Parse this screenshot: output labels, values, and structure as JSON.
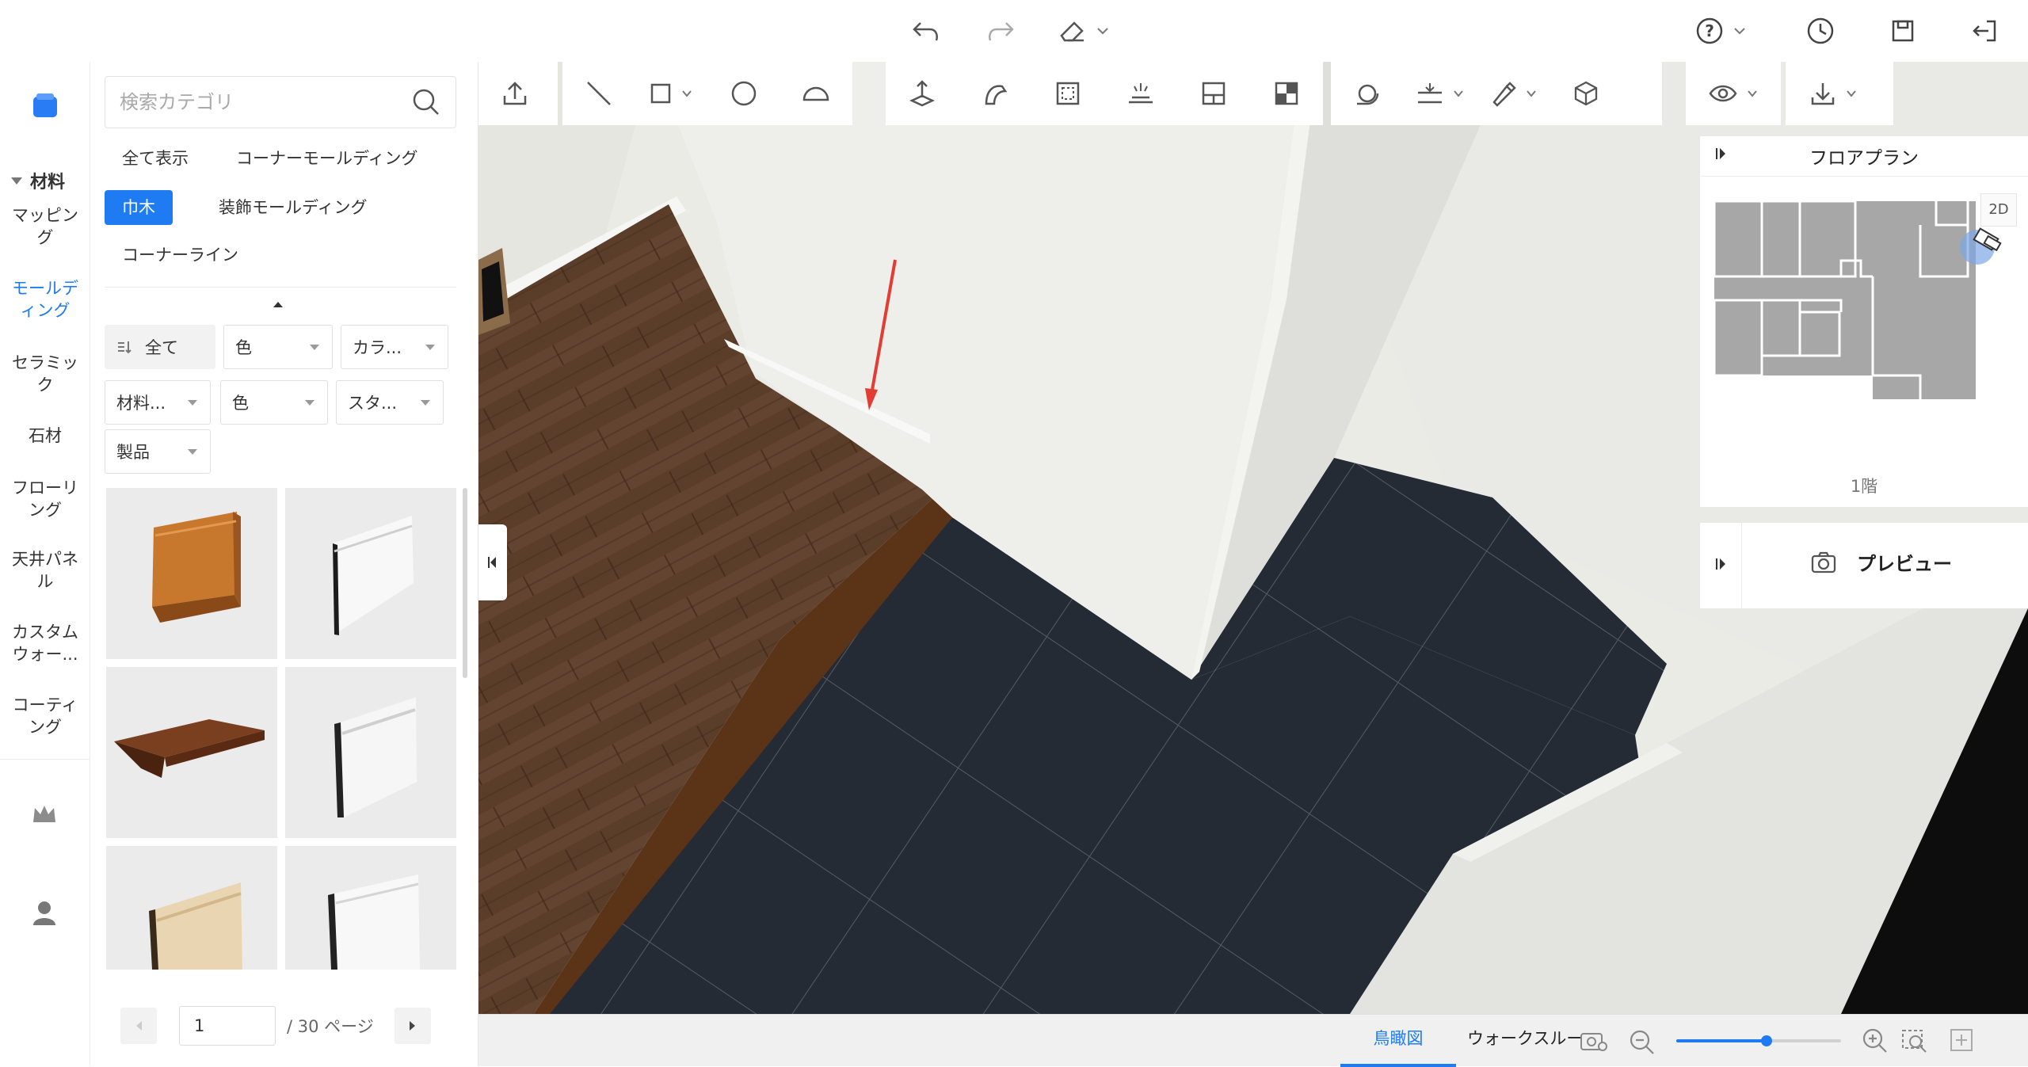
{
  "topbar": {
    "icons": [
      "undo-icon",
      "redo-icon",
      "eraser-icon",
      "help-icon",
      "history-icon",
      "save-icon",
      "exit-icon"
    ]
  },
  "rail": {
    "section_title": "材料",
    "items": [
      {
        "label": "マッピング"
      },
      {
        "label": "モールディング",
        "active": true
      },
      {
        "label": "セラミック"
      },
      {
        "label": "石材"
      },
      {
        "label": "フローリング"
      },
      {
        "label": "天井パネル"
      },
      {
        "label": "カスタムウォー..."
      },
      {
        "label": "コーティング"
      }
    ]
  },
  "catpanel": {
    "search_placeholder": "検索カテゴリ",
    "categories": [
      {
        "label": "全て表示"
      },
      {
        "label": "コーナーモールディング"
      },
      {
        "label": "巾木",
        "active": true
      },
      {
        "label": "装飾モールディング"
      },
      {
        "label": "コーナーライン"
      }
    ],
    "sort_label": "全て",
    "filters": [
      "色",
      "カラ...",
      "材料...",
      "色",
      "スタ...",
      "製品"
    ],
    "products": [
      {
        "name": "wood-baseboard",
        "color": "#c4752a"
      },
      {
        "name": "white-baseboard",
        "color": "#f6f6f6"
      },
      {
        "name": "walnut-cornice",
        "color": "#6a3a1e"
      },
      {
        "name": "white-tall-baseboard",
        "color": "#f4f4f4"
      },
      {
        "name": "pine-baseboard",
        "color": "#e8d3b0"
      },
      {
        "name": "white-flat-baseboard",
        "color": "#f7f7f7"
      }
    ],
    "pager": {
      "current": "1",
      "total_label": "/ 30 ページ"
    }
  },
  "tools": {
    "groups": [
      [
        "upload-icon"
      ],
      [
        "line-icon",
        "rectangle-icon",
        "circle-icon",
        "arc-icon"
      ],
      [
        "extrude-icon",
        "sweep-icon",
        "select-area-icon",
        "light-icon",
        "window-icon",
        "split-icon"
      ],
      [
        "view-rotate-icon",
        "align-icon",
        "brush-icon",
        "cube-icon"
      ],
      [
        "eye-icon"
      ],
      [
        "download-icon"
      ]
    ]
  },
  "floorplan": {
    "title": "フロアプラン",
    "mode_badge": "2D",
    "floor_label": "1階"
  },
  "preview": {
    "label": "プレビュー"
  },
  "bottombar": {
    "tabs": [
      {
        "label": "鳥瞰図",
        "active": true
      },
      {
        "label": "ウォークスルー"
      }
    ],
    "zoom_level": 0.55
  },
  "colors": {
    "accent": "#1f7bf2",
    "floor_tile": "#252b35",
    "wood_floor": "#5a3d28",
    "wall": "#eeeeea",
    "arrow": "#e23c33"
  }
}
